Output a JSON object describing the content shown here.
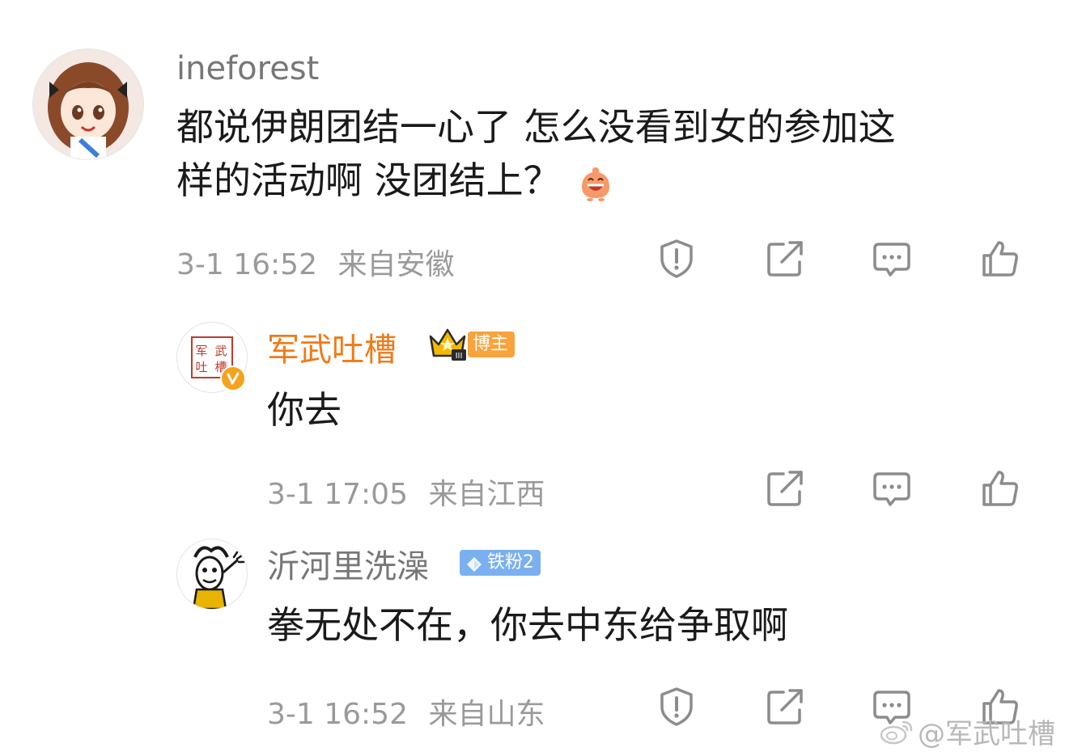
{
  "comments": [
    {
      "username": "ineforest",
      "text_line1": "都说伊朗团结一心了 怎么没看到女的参加这",
      "text_line2": "样的活动啊 没团结上？",
      "timestamp": "3-1 16:52",
      "location": "来自安徽",
      "emoji_icon": "laughing-emoji-icon"
    },
    {
      "username": "军武吐槽",
      "username_color": "#f07a16",
      "badge": "博主",
      "avatar_text": "军武吐槽",
      "text": "你去",
      "timestamp": "3-1 17:05",
      "location": "来自江西"
    },
    {
      "username": "沂河里洗澡",
      "badge": "铁粉2",
      "text": "拳无处不在，你去中东给争取啊",
      "timestamp": "3-1 16:52",
      "location": "来自山东"
    }
  ],
  "watermark": "@军武吐槽",
  "icons": {
    "report": "report-icon",
    "share": "share-icon",
    "reply": "comment-icon",
    "like": "thumbs-up-icon"
  },
  "colors": {
    "accent_orange": "#f07a16",
    "meta_gray": "#9a9a9a",
    "fan_badge_blue": "#7ab0f0"
  }
}
